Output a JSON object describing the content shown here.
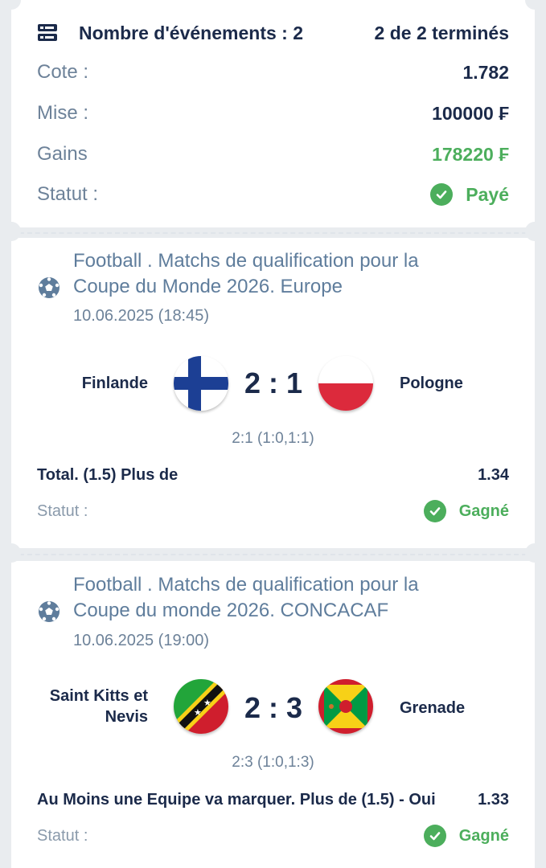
{
  "summary": {
    "events_label": "Nombre d'événements : 2",
    "completed_label": "2 de 2 terminés",
    "rows": [
      {
        "label": "Cote :",
        "value": "1.782"
      },
      {
        "label": "Mise :",
        "value": "100000 ₣"
      },
      {
        "label": "Gains",
        "value": "178220 ₣"
      },
      {
        "label": "Statut :",
        "value": "Payé"
      }
    ]
  },
  "events": [
    {
      "title_line1": "Football . Matchs de qualification pour la",
      "title_line2": "Coupe du Monde 2026. Europe",
      "date": "10.06.2025 (18:45)",
      "home": "Finlande",
      "away": "Pologne",
      "score": "2 : 1",
      "detail": "2:1 (1:0,1:1)",
      "market": "Total. (1.5) Plus de",
      "odds": "1.34",
      "status_label": "Statut :",
      "status": "Gagné"
    },
    {
      "title_line1": "Football . Matchs de qualification pour la",
      "title_line2": "Coupe du monde 2026. CONCACAF",
      "date": "10.06.2025 (19:00)",
      "home_line1": "Saint Kitts et",
      "home_line2": "Nevis",
      "away": "Grenade",
      "score": "2 : 3",
      "detail": "2:3 (1:0,1:3)",
      "market": "Au Moins une Equipe va marquer. Plus de (1.5) - Oui",
      "odds": "1.33",
      "status_label": "Statut :",
      "status": "Gagné"
    }
  ],
  "colors": {
    "accent_green": "#4cae5c",
    "text_dark": "#1b2a4a",
    "muted": "#6d8299"
  },
  "icons": [
    "list-icon",
    "check-icon",
    "football-icon",
    "flag-finland-icon",
    "flag-poland-icon",
    "flag-saint-kitts-nevis-icon",
    "flag-grenada-icon"
  ]
}
